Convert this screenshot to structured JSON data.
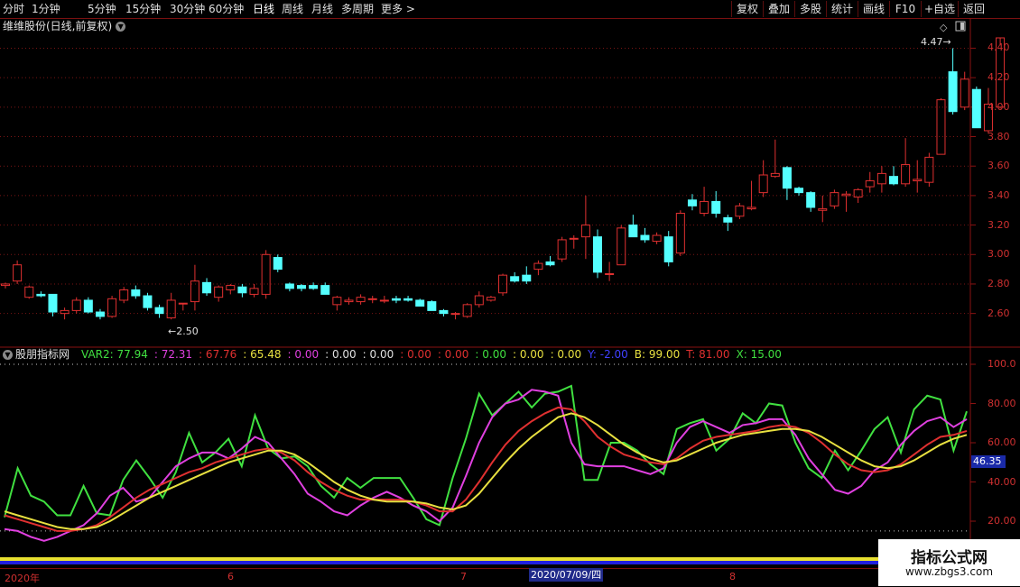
{
  "toolbar": {
    "periods": [
      "分时",
      "1分钟",
      "5分钟",
      "15分钟",
      "30分钟",
      "60分钟",
      "日线",
      "周线",
      "月线",
      "多周期",
      "更多 >"
    ],
    "actions": [
      "复权",
      "叠加",
      "多股",
      "统计",
      "画线",
      "F10",
      "+自选",
      "返回"
    ]
  },
  "stock": {
    "title": "维维股份(日线,前复权)"
  },
  "price_chart": {
    "annotations": {
      "low": "2.50",
      "high": "4.47"
    },
    "axis_ticks": [
      "4.40",
      "4.20",
      "4.00",
      "3.80",
      "3.60",
      "3.40",
      "3.20",
      "3.00",
      "2.80",
      "2.60"
    ],
    "axis_values": [
      4.4,
      4.2,
      4.0,
      3.8,
      3.6,
      3.4,
      3.2,
      3.0,
      2.8,
      2.6
    ],
    "up_color": "#e03030",
    "down_color": "#54ffff",
    "candles": [
      [
        2.79,
        2.81,
        2.77,
        2.8
      ],
      [
        2.82,
        2.96,
        2.8,
        2.93
      ],
      [
        2.71,
        2.79,
        2.7,
        2.78
      ],
      [
        2.73,
        2.75,
        2.71,
        2.72
      ],
      [
        2.73,
        2.67,
        2.58,
        2.61
      ],
      [
        2.6,
        2.64,
        2.56,
        2.62
      ],
      [
        2.62,
        2.71,
        2.6,
        2.69
      ],
      [
        2.69,
        2.71,
        2.6,
        2.61
      ],
      [
        2.61,
        2.63,
        2.56,
        2.58
      ],
      [
        2.58,
        2.72,
        2.57,
        2.7
      ],
      [
        2.69,
        2.78,
        2.67,
        2.76
      ],
      [
        2.76,
        2.79,
        2.7,
        2.72
      ],
      [
        2.72,
        2.74,
        2.62,
        2.64
      ],
      [
        2.64,
        2.66,
        2.57,
        2.6
      ],
      [
        2.57,
        2.74,
        2.56,
        2.69
      ],
      [
        2.67,
        2.67,
        2.62,
        2.67
      ],
      [
        2.68,
        2.93,
        2.62,
        2.82
      ],
      [
        2.81,
        2.84,
        2.72,
        2.74
      ],
      [
        2.71,
        2.79,
        2.68,
        2.78
      ],
      [
        2.76,
        2.8,
        2.73,
        2.79
      ],
      [
        2.78,
        2.8,
        2.71,
        2.74
      ],
      [
        2.73,
        2.8,
        2.71,
        2.77
      ],
      [
        2.73,
        3.03,
        2.7,
        3.0
      ],
      [
        2.98,
        3.0,
        2.88,
        2.9
      ],
      [
        2.8,
        2.81,
        2.75,
        2.77
      ],
      [
        2.79,
        2.8,
        2.75,
        2.77
      ],
      [
        2.79,
        2.81,
        2.76,
        2.77
      ],
      [
        2.79,
        2.81,
        2.74,
        2.73
      ],
      [
        2.66,
        2.72,
        2.62,
        2.71
      ],
      [
        2.68,
        2.71,
        2.66,
        2.69
      ],
      [
        2.68,
        2.73,
        2.66,
        2.71
      ],
      [
        2.7,
        2.72,
        2.67,
        2.7
      ],
      [
        2.69,
        2.72,
        2.67,
        2.69
      ],
      [
        2.7,
        2.72,
        2.67,
        2.69
      ],
      [
        2.7,
        2.72,
        2.68,
        2.69
      ],
      [
        2.69,
        2.7,
        2.65,
        2.65
      ],
      [
        2.68,
        2.69,
        2.63,
        2.62
      ],
      [
        2.62,
        2.63,
        2.58,
        2.6
      ],
      [
        2.6,
        2.61,
        2.56,
        2.6
      ],
      [
        2.58,
        2.67,
        2.57,
        2.66
      ],
      [
        2.66,
        2.75,
        2.64,
        2.72
      ],
      [
        2.69,
        2.72,
        2.68,
        2.71
      ],
      [
        2.74,
        2.87,
        2.72,
        2.86
      ],
      [
        2.85,
        2.88,
        2.81,
        2.82
      ],
      [
        2.86,
        2.92,
        2.8,
        2.82
      ],
      [
        2.9,
        2.96,
        2.86,
        2.94
      ],
      [
        2.95,
        2.99,
        2.92,
        2.93
      ],
      [
        2.97,
        3.12,
        2.95,
        3.1
      ],
      [
        3.11,
        3.13,
        3.04,
        3.11
      ],
      [
        3.12,
        3.4,
        2.97,
        3.2
      ],
      [
        3.12,
        3.17,
        2.84,
        2.88
      ],
      [
        2.87,
        2.95,
        2.82,
        2.87
      ],
      [
        2.93,
        3.2,
        2.93,
        3.18
      ],
      [
        3.2,
        3.27,
        3.13,
        3.12
      ],
      [
        3.13,
        3.18,
        3.08,
        3.1
      ],
      [
        3.09,
        3.15,
        3.07,
        3.13
      ],
      [
        3.12,
        3.16,
        2.92,
        2.95
      ],
      [
        3.01,
        3.3,
        2.99,
        3.28
      ],
      [
        3.37,
        3.41,
        3.3,
        3.33
      ],
      [
        3.28,
        3.46,
        3.26,
        3.36
      ],
      [
        3.36,
        3.43,
        3.25,
        3.28
      ],
      [
        3.25,
        3.27,
        3.16,
        3.22
      ],
      [
        3.26,
        3.35,
        3.24,
        3.33
      ],
      [
        3.31,
        3.5,
        3.3,
        3.32
      ],
      [
        3.42,
        3.64,
        3.39,
        3.54
      ],
      [
        3.53,
        3.78,
        3.52,
        3.55
      ],
      [
        3.59,
        3.6,
        3.37,
        3.45
      ],
      [
        3.45,
        3.46,
        3.4,
        3.42
      ],
      [
        3.42,
        3.43,
        3.29,
        3.32
      ],
      [
        3.3,
        3.4,
        3.22,
        3.31
      ],
      [
        3.33,
        3.44,
        3.31,
        3.42
      ],
      [
        3.4,
        3.43,
        3.29,
        3.41
      ],
      [
        3.39,
        3.45,
        3.35,
        3.44
      ],
      [
        3.46,
        3.56,
        3.42,
        3.5
      ],
      [
        3.48,
        3.6,
        3.42,
        3.55
      ],
      [
        3.53,
        3.6,
        3.47,
        3.48
      ],
      [
        3.48,
        3.79,
        3.46,
        3.61
      ],
      [
        3.5,
        3.64,
        3.42,
        3.51
      ],
      [
        3.49,
        3.69,
        3.46,
        3.66
      ],
      [
        3.68,
        4.06,
        3.68,
        4.05
      ],
      [
        4.24,
        4.4,
        3.95,
        3.97
      ],
      [
        4.0,
        4.24,
        3.98,
        4.19
      ],
      [
        4.12,
        4.14,
        3.88,
        3.86
      ],
      [
        3.84,
        4.13,
        3.82,
        4.02
      ],
      [
        4.0,
        4.42,
        3.99,
        4.47
      ]
    ]
  },
  "indicator": {
    "name": "股朋指标网",
    "legend": [
      {
        "text": "VAR2: 77.94",
        "color": "#40e040"
      },
      {
        "text": ": 72.31",
        "color": "#e040e0"
      },
      {
        "text": ": 67.76",
        "color": "#e03030"
      },
      {
        "text": ": 65.48",
        "color": "#e8e040"
      },
      {
        "text": ": 0.00",
        "color": "#e040e0"
      },
      {
        "text": ": 0.00",
        "color": "#e0e0e0"
      },
      {
        "text": ": 0.00",
        "color": "#e0e0e0"
      },
      {
        "text": ": 0.00",
        "color": "#e03030"
      },
      {
        "text": ": 0.00",
        "color": "#e03030"
      },
      {
        "text": ": 0.00",
        "color": "#40e040"
      },
      {
        "text": ": 0.00",
        "color": "#e8e040"
      },
      {
        "text": ": 0.00",
        "color": "#e8e040"
      },
      {
        "text": "Y: -2.00",
        "color": "#4040ff"
      },
      {
        "text": "B: 99.00",
        "color": "#e8e040"
      },
      {
        "text": "T: 81.00",
        "color": "#e03030"
      },
      {
        "text": "X: 15.00",
        "color": "#40e040"
      }
    ],
    "axis_ticks": [
      "100.0",
      "80.00",
      "60.00",
      "40.00",
      "20.00"
    ],
    "axis_values": [
      100,
      80,
      60,
      40,
      20
    ],
    "current_value": "46.35",
    "series": [
      {
        "color": "#40e040",
        "values": [
          22,
          47,
          33,
          30,
          23,
          23,
          38,
          24,
          23,
          41,
          51,
          42,
          32,
          45,
          65,
          50,
          55,
          62,
          48,
          74,
          57,
          52,
          53,
          48,
          38,
          32,
          42,
          37,
          42,
          42,
          42,
          32,
          21,
          18,
          42,
          62,
          85,
          74,
          80,
          86,
          78,
          85,
          86,
          89,
          41,
          41,
          60,
          60,
          56,
          49,
          44,
          67,
          70,
          72,
          56,
          62,
          75,
          70,
          80,
          79,
          60,
          47,
          42,
          56,
          46,
          56,
          67,
          73,
          55,
          77,
          84,
          82,
          56,
          76
        ]
      },
      {
        "color": "#e040e0",
        "values": [
          16,
          15,
          12,
          10,
          12,
          15,
          18,
          24,
          33,
          37,
          30,
          32,
          40,
          48,
          52,
          55,
          55,
          52,
          57,
          63,
          60,
          52,
          44,
          34,
          30,
          25,
          23,
          28,
          32,
          35,
          32,
          28,
          25,
          20,
          27,
          43,
          60,
          73,
          80,
          82,
          87,
          86,
          84,
          60,
          49,
          48,
          48,
          48,
          46,
          44,
          47,
          60,
          68,
          71,
          68,
          65,
          69,
          70,
          72,
          72,
          64,
          52,
          44,
          36,
          34,
          38,
          46,
          50,
          59,
          66,
          71,
          73,
          68,
          72
        ]
      },
      {
        "color": "#e03030",
        "values": [
          23,
          21,
          19,
          17,
          15,
          15,
          16,
          18,
          22,
          27,
          32,
          36,
          39,
          42,
          45,
          47,
          50,
          52,
          54,
          56,
          57,
          55,
          51,
          45,
          40,
          36,
          33,
          31,
          31,
          31,
          31,
          30,
          28,
          25,
          25,
          31,
          40,
          50,
          59,
          66,
          71,
          75,
          78,
          77,
          71,
          63,
          58,
          54,
          52,
          50,
          49,
          52,
          57,
          61,
          63,
          64,
          65,
          66,
          68,
          69,
          68,
          65,
          60,
          54,
          49,
          46,
          45,
          46,
          49,
          54,
          59,
          63,
          64,
          66
        ]
      },
      {
        "color": "#e8e040",
        "values": [
          25,
          23,
          21,
          19,
          17,
          16,
          16,
          17,
          20,
          24,
          28,
          32,
          35,
          38,
          41,
          44,
          47,
          50,
          52,
          54,
          56,
          56,
          54,
          50,
          45,
          40,
          36,
          33,
          31,
          30,
          30,
          30,
          29,
          27,
          26,
          28,
          34,
          42,
          50,
          57,
          63,
          68,
          73,
          75,
          73,
          69,
          64,
          59,
          55,
          52,
          50,
          51,
          54,
          57,
          60,
          62,
          64,
          65,
          66,
          67,
          67,
          66,
          63,
          59,
          55,
          51,
          48,
          47,
          48,
          51,
          55,
          59,
          62,
          64
        ]
      }
    ]
  },
  "dates": {
    "labels": [
      "2020年",
      "6",
      "7",
      "8"
    ],
    "selected": "2020/07/09/四"
  },
  "watermark": {
    "title": "指标公式网",
    "url": "www.zbgs3.com"
  },
  "icons": {
    "settings": "diamond-icon",
    "menu": "circle-chevron-icon",
    "window": "window-icon"
  }
}
